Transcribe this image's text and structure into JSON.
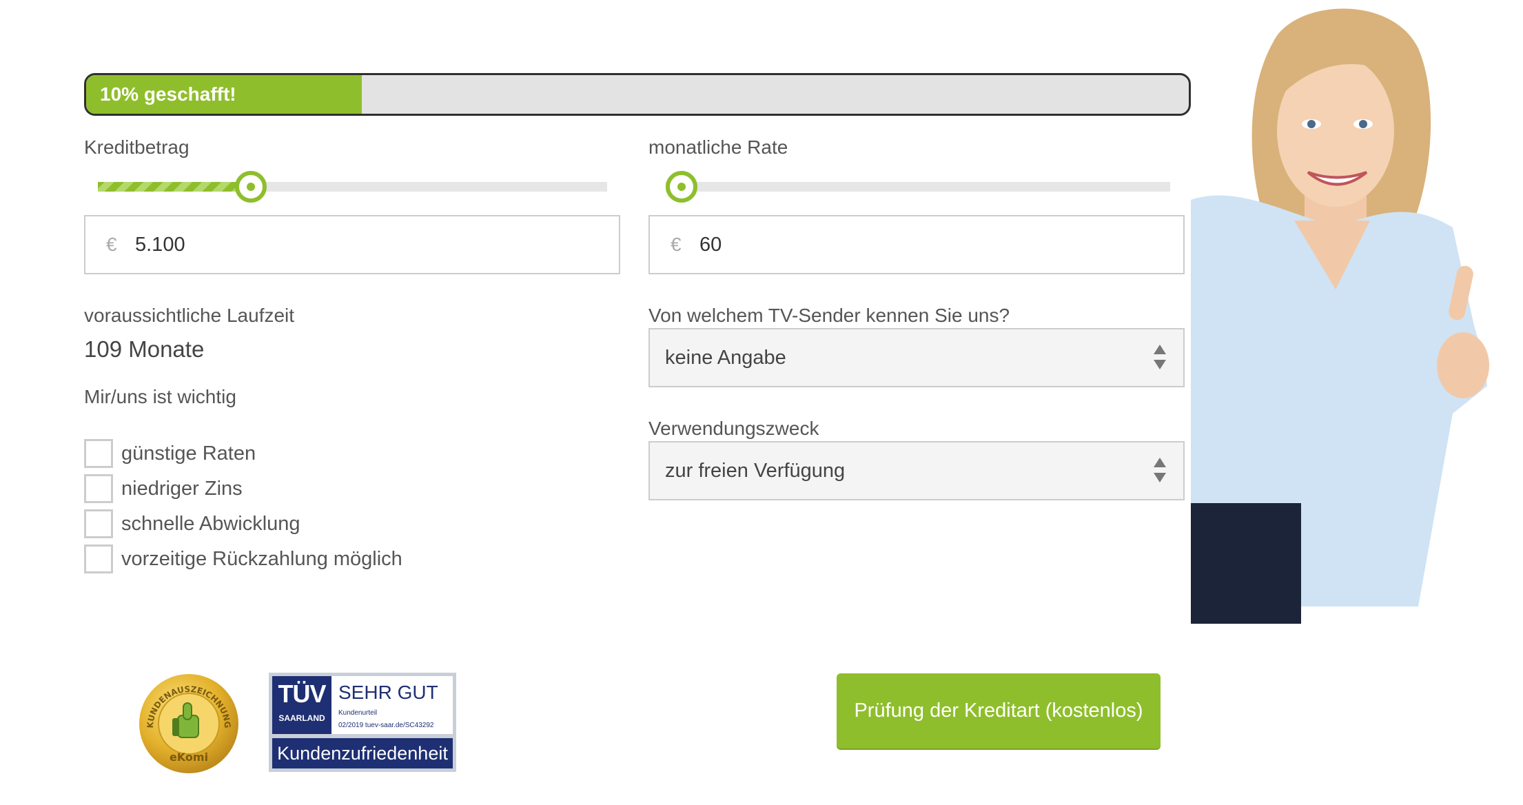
{
  "progress": {
    "text": "10% geschafft!",
    "percent": 10
  },
  "credit_amount": {
    "label": "Kreditbetrag",
    "currency": "€",
    "value": "5.100",
    "slider_fraction": 0.3
  },
  "monthly_rate": {
    "label": "monatliche Rate",
    "currency": "€",
    "value": "60",
    "slider_fraction": 0.0
  },
  "runtime": {
    "label": "voraussichtliche Laufzeit",
    "value": "109 Monate"
  },
  "priorities": {
    "label": "Mir/uns ist wichtig",
    "options": [
      {
        "label": "günstige Raten",
        "checked": false
      },
      {
        "label": "niedriger Zins",
        "checked": false
      },
      {
        "label": "schnelle Abwicklung",
        "checked": false
      },
      {
        "label": "vorzeitige Rückzahlung möglich",
        "checked": false
      }
    ]
  },
  "tv_channel": {
    "label": "Von welchem TV-Sender kennen Sie uns?",
    "selected": "keine Angabe"
  },
  "purpose": {
    "label": "Verwendungszweck",
    "selected": "zur freien Verfügung"
  },
  "submit": {
    "label": "Prüfung der Kreditart (kostenlos)"
  },
  "seals": {
    "ekomi": {
      "ring_text": "KUNDENAUSZEICHNUNG",
      "brand": "eKomi"
    },
    "tuv": {
      "logo": "TÜV",
      "region": "SAARLAND",
      "rating": "SEHR GUT",
      "subtitle": "Kundenurteil",
      "reference": "02/2019  tuev-saar.de/SC43292",
      "banner": "Kundenzufriedenheit"
    }
  },
  "colors": {
    "accent": "#8fbe2c",
    "tuv_blue": "#1e2f73",
    "gold": "#d9a521"
  },
  "icons": {
    "handle": "slider-handle-icon",
    "select": "select-arrows-icon",
    "thumb": "thumbs-up-icon"
  }
}
